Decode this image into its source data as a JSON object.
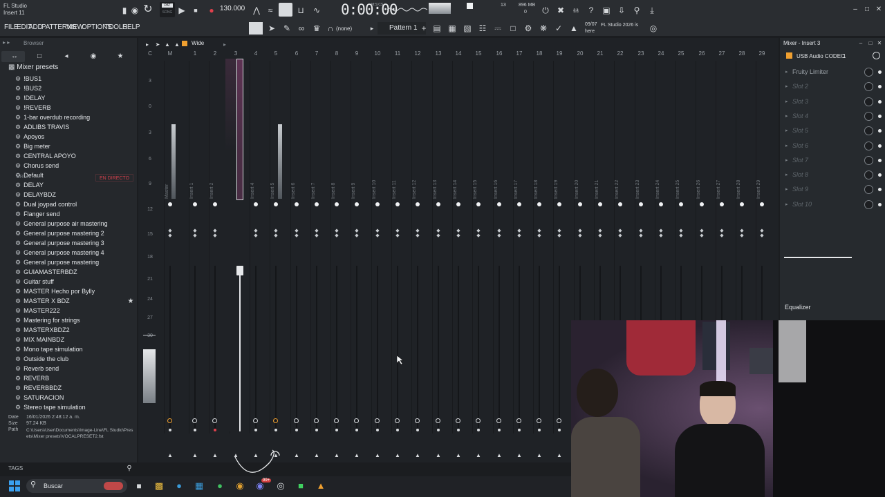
{
  "window": {
    "app_title": "FL Studio",
    "subtitle": "Insert 11"
  },
  "transport": {
    "tempo": "130.000",
    "time": "0:00:00",
    "time_unit": "M:S:CS",
    "pat_label": "PAT",
    "song_label": "SONG",
    "cpu_num": "13",
    "memory": "896 MB",
    "poly": "0"
  },
  "menu": [
    "FILE",
    "EDIT",
    "ADD",
    "PATTERNS",
    "VIEW",
    "OPTIONS",
    "TOOLS",
    "HELP"
  ],
  "toolbar2": {
    "preset_label": "(none)",
    "pattern_label": "Pattern 1",
    "news_date": "09/07",
    "news_text": "FL Studio 2026 is here"
  },
  "browser": {
    "title": "Browser",
    "folder": "Mixer presets",
    "items": [
      "!BUS1",
      "!BUS2",
      "!DELAY",
      "!REVERB",
      "1-bar overdub recording",
      "ADLIBS TRAVIS",
      "Apoyos",
      "Big meter",
      "CENTRAL APOYO",
      "Chorus send",
      "Default",
      "DELAY",
      "DELAYBDZ",
      "Dual joypad control",
      "Flanger send",
      "General purpose air mastering",
      "General purpose mastering 2",
      "General purpose mastering 3",
      "General purpose mastering 4",
      "General purpose mastering",
      "GUIAMASTERBDZ",
      "Guitar stuff",
      "MASTER Hecho por Bylly",
      "MASTER X BDZ",
      "MASTER222",
      "Mastering for strings",
      "MASTERXBDZ2",
      "MIX MAINBDZ",
      "Mono tape simulation",
      "Outside the club",
      "Reverb send",
      "REVERB",
      "REVERBBDZ",
      "SATURACION",
      "Stereo tape simulation"
    ],
    "overlay_text": {
      "bruh": "BRUH",
      "live": "EN DIRECTO"
    },
    "info": {
      "date_label": "Date",
      "date_value": "16/01/2026 2:48:12 a. m.",
      "size_label": "Size",
      "size_value": "97.24 KB",
      "path_label": "Path",
      "path_value": "C:\\Users\\User\\Documents\\Image-Line\\FL Studio\\Presets\\Mixer presets\\VOCALPRESET2.fst"
    },
    "tags_label": "TAGS"
  },
  "mixer": {
    "view_mode": "Wide",
    "scale": [
      "3",
      "0",
      "3",
      "6",
      "9",
      "12",
      "15",
      "18",
      "21",
      "24",
      "27",
      "30"
    ],
    "columns": [
      "C",
      "M",
      "1",
      "2",
      "3",
      "4",
      "5",
      "6",
      "7",
      "8",
      "9",
      "10",
      "11",
      "12",
      "13",
      "14",
      "15",
      "16",
      "17",
      "18",
      "19",
      "20",
      "21",
      "22",
      "23",
      "24",
      "25",
      "26",
      "27",
      "28",
      "29"
    ],
    "tracks": [
      "Master",
      "Insert 1",
      "Insert 2",
      "Insert 3",
      "Insert 4",
      "Insert 5",
      "Insert 6",
      "Insert 7",
      "Insert 8",
      "Insert 9",
      "Insert 10",
      "Insert 11",
      "Insert 12",
      "Insert 13",
      "Insert 14",
      "Insert 15",
      "Insert 16",
      "Insert 17",
      "Insert 18",
      "Insert 19",
      "Insert 20",
      "Insert 21",
      "Insert 22",
      "Insert 23",
      "Insert 24",
      "Insert 25",
      "Insert 26",
      "Insert 27",
      "Insert 28",
      "Insert 29"
    ],
    "selected_track": "Insert 3"
  },
  "insert_panel": {
    "title": "Mixer - Insert 3",
    "input_device": "USB Audio CODEC",
    "input_channel": "1",
    "slots": [
      "Fruity Limiter",
      "Slot 2",
      "Slot 3",
      "Slot 4",
      "Slot 5",
      "Slot 6",
      "Slot 7",
      "Slot 8",
      "Slot 9",
      "Slot 10"
    ],
    "eq_label": "Equalizer"
  },
  "taskbar": {
    "search_placeholder": "Buscar",
    "chat_badge": "99+"
  },
  "colors": {
    "accent": "#f0a030",
    "selected": "#c050a0",
    "record": "#e0404c",
    "live": "#d2404c"
  }
}
